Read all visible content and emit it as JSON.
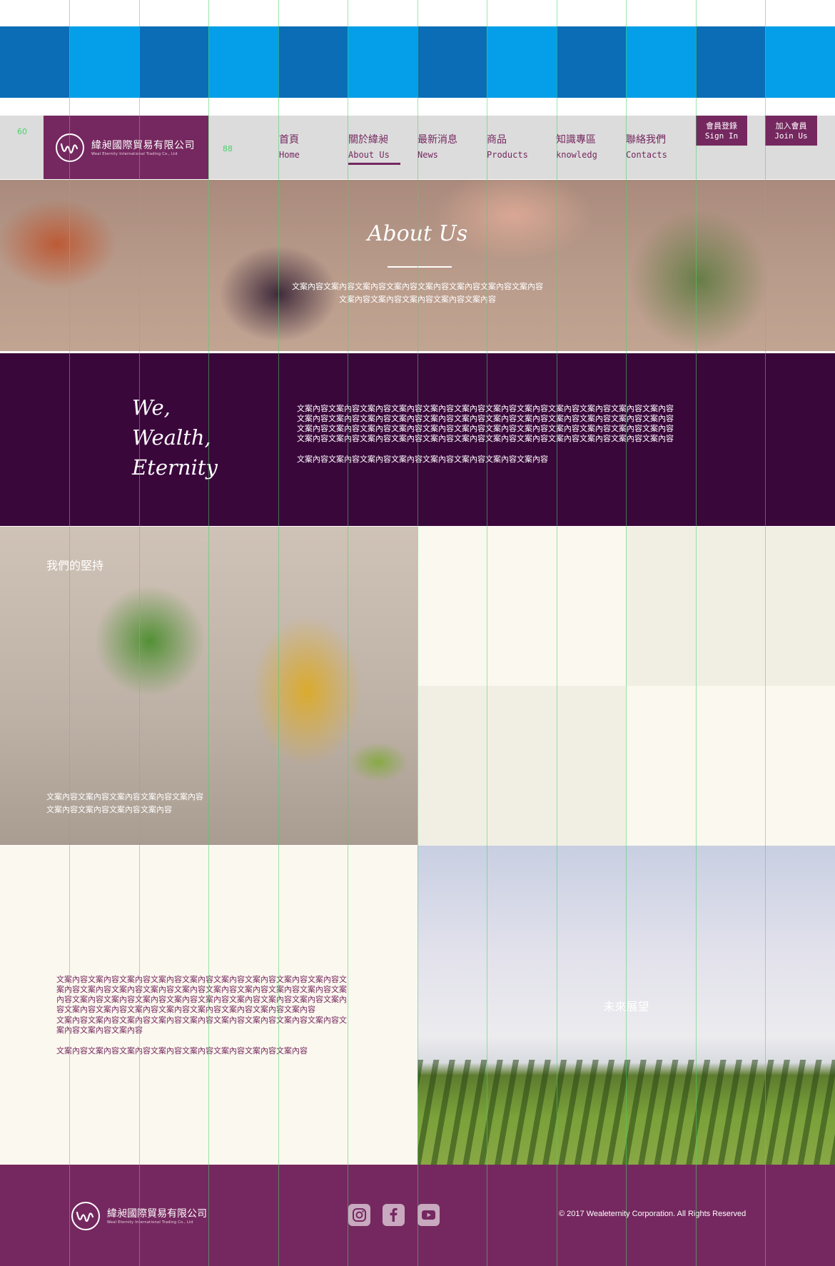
{
  "colors": {
    "brand_purple": "#75285f",
    "deep_purple": "#3a073b",
    "header_gray": "#dcdcdc",
    "cream": "#fbf8ef",
    "cream_alt": "#f1efe4",
    "grid_blue_dark": "#0a6db5",
    "grid_blue_light": "#049fe8",
    "guide_green": "#48d26a"
  },
  "guides": {
    "left_margin": "60",
    "header_height": "88"
  },
  "brand": {
    "name_cn": "緯昶國際貿易有限公司",
    "name_en": "Weal Eternity International Trading Co., Ltd",
    "logo_icon": "wm-monogram-icon"
  },
  "nav": {
    "items": [
      {
        "cn": "首頁",
        "en": "Home"
      },
      {
        "cn": "關於緯昶",
        "en": "About Us"
      },
      {
        "cn": "最新消息",
        "en": "News"
      },
      {
        "cn": "商品",
        "en": "Products"
      },
      {
        "cn": "知識專區",
        "en": "knowledg"
      },
      {
        "cn": "聯絡我們",
        "en": "Contacts"
      }
    ],
    "active_index": 1
  },
  "member": {
    "sign_in_cn": "會員登錄",
    "sign_in_en": "Sign In",
    "join_cn": "加入會員",
    "join_en": "Join Us"
  },
  "hero": {
    "title": "About Us",
    "lines": [
      "文案內容文案內容文案內容文案內容文案內容文案內容文案內容文案內容",
      "文案內容文案內容文案內容文案內容文案內容"
    ]
  },
  "motto": {
    "lines": [
      "We,",
      "Wealth,",
      "Eternity"
    ],
    "paragraph_lines": [
      "文案內容文案內容文案內容文案內容文案內容文案內容文案內容文案內容文案內容文案內容文案內容文案內容",
      "文案內容文案內容文案內容文案內容文案內容文案內容文案內容文案內容文案內容文案內容文案內容文案內容",
      "文案內容文案內容文案內容文案內容文案內容文案內容文案內容文案內容文案內容文案內容文案內容文案內容",
      "文案內容文案內容文案內容文案內容文案內容文案內容文案內容文案內容文案內容文案內容文案內容文案內容"
    ],
    "paragraph_last": "文案內容文案內容文案內容文案內容文案內容文案內容文案內容文案內容"
  },
  "persistence": {
    "title": "我們的堅持",
    "lines": [
      "文案內容文案內容文案內容文案內容文案內容",
      "文案內容文案內容文案內容文案內容"
    ]
  },
  "story": {
    "lines": [
      "文案內容文案內容文案內容文案內容文案內容文案內容文案內容文案內容文案內容文",
      "案內容文案內容文案內容文案內容文案內容文案內容文案內容文案內容文案內容文案",
      "內容文案內容文案內容文案內容文案內容文案內容文案內容文案內容文案內容文案內",
      "容文案內容文案內容文案內容文案內容文案內容文案內容文案內容文案內容",
      "文案內容文案內容文案內容文案內容文案內容文案內容文案內容文案內容文案內容文",
      "案內容文案內容文案內容"
    ],
    "last": "文案內容文案內容文案內容文案內容文案內容文案內容文案內容文案內容"
  },
  "future": {
    "title": "未來展望"
  },
  "footer": {
    "social": [
      "instagram-icon",
      "facebook-icon",
      "youtube-icon"
    ],
    "copyright": "© 2017 Wealeternity Corporation. All Rights Reserved"
  }
}
